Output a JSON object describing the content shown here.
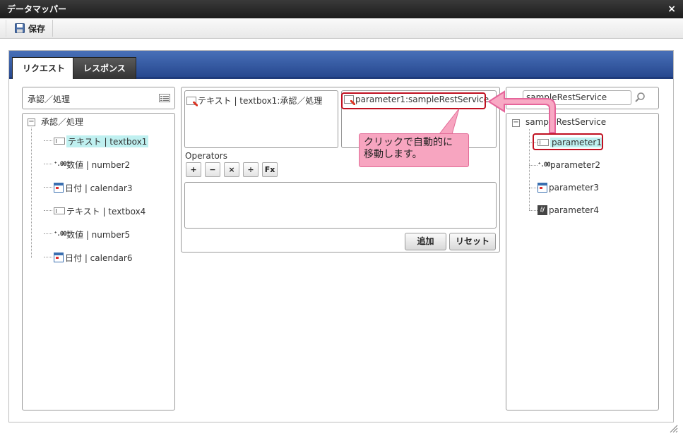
{
  "window": {
    "title": "データマッパー",
    "close_icon": "×"
  },
  "toolbar": {
    "save_label": "保存"
  },
  "tabs": [
    {
      "label": "リクエスト",
      "active": true
    },
    {
      "label": "レスポンス",
      "active": false
    }
  ],
  "left_panel": {
    "header": "承認／処理",
    "tree_root": "承認／処理",
    "items": [
      {
        "label": "テキスト | textbox1",
        "icon": "textbox-icon",
        "highlighted": true
      },
      {
        "label": "数値 | number2",
        "icon": "number-icon",
        "highlighted": false
      },
      {
        "label": "日付 | calendar3",
        "icon": "calendar-icon",
        "highlighted": false
      },
      {
        "label": "テキスト | textbox4",
        "icon": "textbox-icon",
        "highlighted": false
      },
      {
        "label": "数値 | number5",
        "icon": "number-icon",
        "highlighted": false
      },
      {
        "label": "日付 | calendar6",
        "icon": "calendar-icon",
        "highlighted": false
      }
    ]
  },
  "middle": {
    "source_field": "テキスト | textbox1:承認／処理",
    "target_field": "parameter1:sampleRestService",
    "operators_label": "Operators",
    "operators": [
      "+",
      "−",
      "×",
      "÷",
      "Fx"
    ],
    "add_button": "追加",
    "reset_button": "リセット"
  },
  "callout": {
    "line1": "クリックで自動的に",
    "line2": "移動します。"
  },
  "right_panel": {
    "search_value": "sampleRestService",
    "tree_root": "sampleRestService",
    "items": [
      {
        "label": "parameter1",
        "icon": "textbox-icon",
        "highlighted": true
      },
      {
        "label": "parameter2",
        "icon": "number-icon",
        "highlighted": false
      },
      {
        "label": "parameter3",
        "icon": "calendar-icon",
        "highlighted": false
      },
      {
        "label": "parameter4",
        "icon": "format-icon",
        "highlighted": false
      }
    ]
  },
  "colors": {
    "accent_pink": "#f06a9a",
    "highlight_red": "#c01020",
    "tab_blue": "#2f56a0"
  }
}
